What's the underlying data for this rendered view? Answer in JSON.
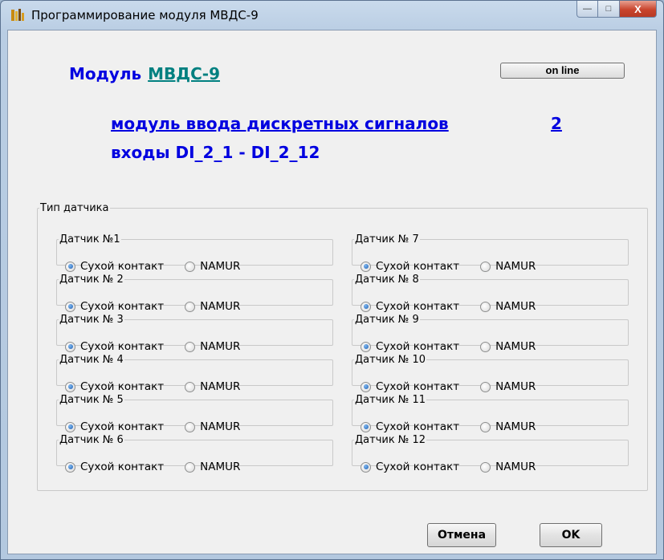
{
  "window": {
    "title": "Программирование модуля  МВДС-9",
    "app_icon": "module-app-icon",
    "buttons": {
      "minimize": "—",
      "maximize": "□",
      "close": "X"
    }
  },
  "header": {
    "module_label": "Модуль",
    "module_name": "МВДС-9",
    "online_button": "on line",
    "description": "модуль  ввода дискретных сигналов",
    "module_number": "2",
    "inputs_range": "входы DI_2_1 - DI_2_12"
  },
  "sensor_type_group": {
    "legend": "Тип датчика",
    "option_dry": "Сухой контакт",
    "option_namur": "NAMUR",
    "sensors": [
      {
        "label": "Датчик №1",
        "selected": "dry"
      },
      {
        "label": "Датчик № 2",
        "selected": "dry"
      },
      {
        "label": "Датчик № 3",
        "selected": "dry"
      },
      {
        "label": "Датчик № 4",
        "selected": "dry"
      },
      {
        "label": "Датчик № 5",
        "selected": "dry"
      },
      {
        "label": "Датчик № 6",
        "selected": "dry"
      },
      {
        "label": "Датчик № 7",
        "selected": "dry"
      },
      {
        "label": "Датчик № 8",
        "selected": "dry"
      },
      {
        "label": "Датчик № 9",
        "selected": "dry"
      },
      {
        "label": "Датчик № 10",
        "selected": "dry"
      },
      {
        "label": "Датчик № 11",
        "selected": "dry"
      },
      {
        "label": "Датчик № 12",
        "selected": "dry"
      }
    ]
  },
  "footer": {
    "cancel": "Отмена",
    "ok": "OK"
  },
  "colors": {
    "link_blue": "#0000e0",
    "link_teal": "#008080",
    "close_red": "#c9452e"
  }
}
